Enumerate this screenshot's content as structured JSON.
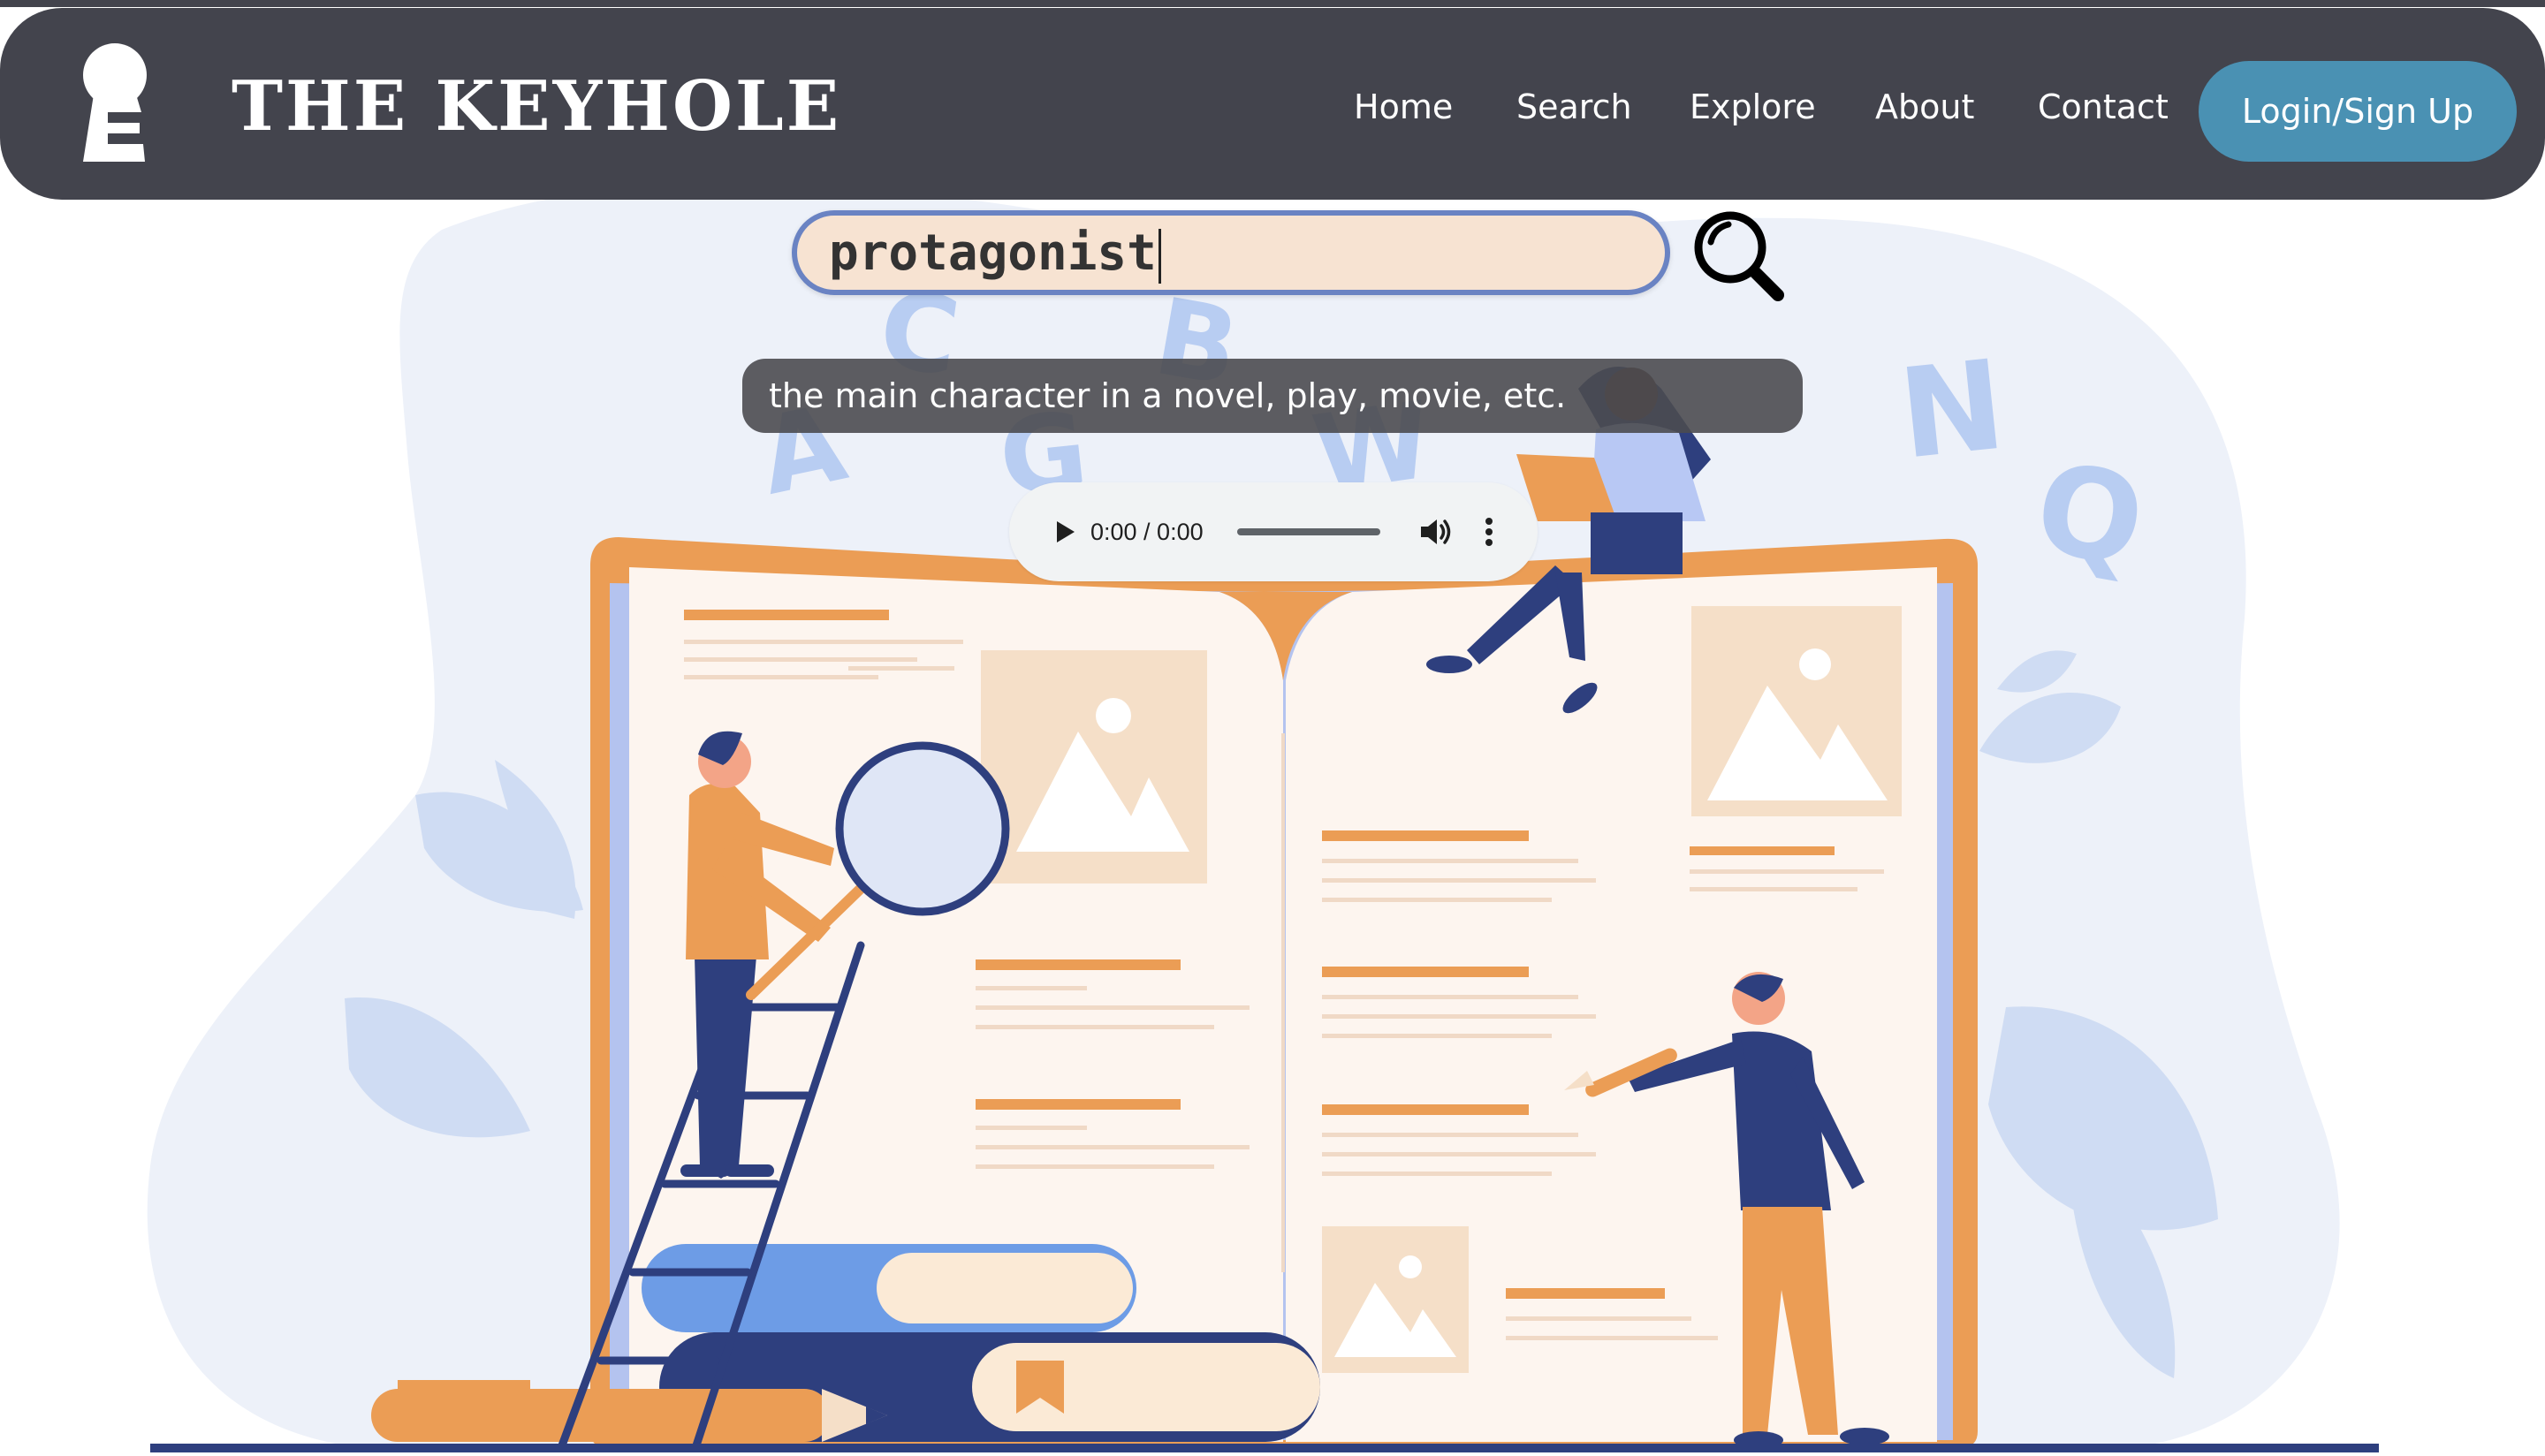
{
  "header": {
    "brand": "THE KEYHOLE",
    "nav": [
      "Home",
      "Search",
      "Explore",
      "About",
      "Contact"
    ],
    "login_label": "Login/Sign Up"
  },
  "search": {
    "query": "protagonist"
  },
  "definition": {
    "text": "the main character in a novel, play, movie, etc."
  },
  "audio": {
    "time": "0:00 / 0:00"
  },
  "illustration": {
    "letters": [
      "A",
      "C",
      "G",
      "B",
      "W",
      "N",
      "Q"
    ]
  },
  "colors": {
    "navbar": "#43444d",
    "login_button": "#4a91b3",
    "search_border": "#6a83c3",
    "search_fill": "#f7e3d2",
    "book_orange": "#eb9d55",
    "book_page": "#fdf5ef",
    "blob": "#edf1f9",
    "leaf": "#cfdcf3",
    "navy": "#2e3f7e"
  }
}
